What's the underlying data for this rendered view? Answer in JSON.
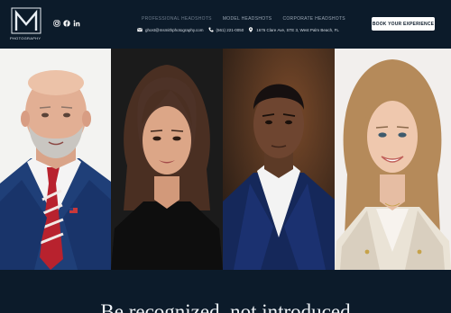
{
  "brand": {
    "logo_letter": "M",
    "logo_caption": "PHOTOGRAPHY"
  },
  "social": [
    {
      "icon": "instagram-icon"
    },
    {
      "icon": "facebook-icon"
    },
    {
      "icon": "linkedin-icon"
    }
  ],
  "nav": {
    "items": [
      "PROFESSIONAL HEADSHOTS",
      "MODEL HEADSHOTS",
      "CORPORATE HEADSHOTS"
    ]
  },
  "contact": {
    "email": "ghost@msmithphotography.com",
    "phone": "(561) 221-0050",
    "address": "1676 Clare Ave, STE 3, West Palm Beach, FL"
  },
  "cta": {
    "label": "BOOK YOUR EXPERIENCE"
  },
  "hero": {
    "tagline": "Be recognized, not introduced"
  },
  "colors": {
    "background": "#0c1b2a",
    "cta_background": "#ffffff",
    "cta_text": "#0c1b2a"
  }
}
